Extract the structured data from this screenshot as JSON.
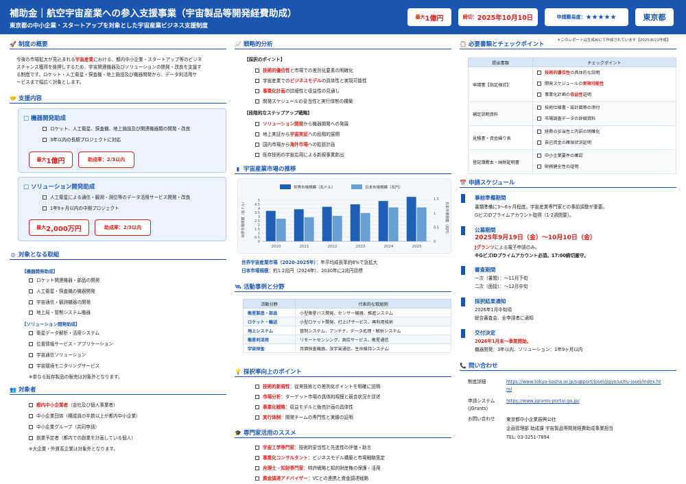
{
  "header": {
    "title": "補助金｜航空宇宙産業への参入支援事業（宇宙製品等開発経費助成）",
    "subtitle": "東京都の中小企業・スタートアップを対象とした宇宙産業ビジネス支援制度",
    "max_label": "最大",
    "max_value": "1億円",
    "deadline_label": "締切：",
    "deadline_value": "2025年10月10日",
    "difficulty_label": "申請難易度：",
    "difficulty_value": "★★★★★",
    "region": "東京都"
  },
  "note": "＊このレポートは生成AIにて作成されています【2025/8/21作成】",
  "overview": {
    "title": "制度の概要",
    "lines": [
      {
        "a": "今後の市場拡大が見込まれる",
        "h": "宇宙産業",
        "b": "における、都内中小企業・スタートアップ等のビジネ"
      },
      {
        "a": "スチャンス獲得を後押しするため、宇宙関連機器及びソリューションの開発・改良を支援す",
        "h": "",
        "b": ""
      },
      {
        "a": "る制度です。ロケット・人工衛星・探査機・地上施設及び機器開発から、データ利活用サ",
        "h": "",
        "b": ""
      },
      {
        "a": "ービスまで幅広く対象とします。",
        "h": "",
        "b": ""
      }
    ]
  },
  "support": {
    "title": "支援内容",
    "cards": [
      {
        "title": "□ 機器開発助成",
        "items": [
          "ロケット、人工衛星、探査機、地上施設及び関連機器類の開発・改良",
          "3年以内の長期プロジェクトに対応"
        ],
        "max_label": "最大",
        "max_value": "1億円",
        "rate": "助成率：2/3以内"
      },
      {
        "title": "□ ソリューション開発助成",
        "items": [
          "人工衛星による通信・観測・測位等のデータ活用サービス開発・改良",
          "1年9ヶ月以内の中期プロジェクト"
        ],
        "max_label": "最大",
        "max_value": "2,000万円",
        "rate": "助成率：2/3以内"
      }
    ]
  },
  "targets": {
    "title": "対象となる取組",
    "groups": [
      {
        "label": "【機器開発助成】",
        "items": [
          "ロケット関連機器・部品の開発",
          "人工衛星・探査機の機器開発",
          "宇宙通信・観測機器の開発",
          "地上局・管制システム機器"
        ]
      },
      {
        "label": "【ソリューション開発助成】",
        "items": [
          "衛星データ解析・活用システム",
          "位置情報サービス・アプリケーション",
          "宇宙通信ソリューション",
          "宇宙環境モニタリングサービス"
        ]
      }
    ],
    "note": "※単なる既存製品の販売は対象外となります。"
  },
  "eligible": {
    "title": "対象者",
    "items": [
      {
        "h": "都内中小企業者",
        "b": "（会社及び個人事業者）"
      },
      {
        "h": "",
        "b": "中小企業団体（構成員の半数以上が都内中小企業）"
      },
      {
        "h": "",
        "b": "中小企業グループ（共同申請）"
      },
      {
        "h": "",
        "b": "創業予定者（都内での創業を計画している個人）"
      }
    ],
    "note": "※大企業・外資系企業は対象外となります。"
  },
  "strategy": {
    "title": "戦略的分析",
    "g1": "【採択のポイント】",
    "points": [
      {
        "h": "技術的優位性",
        "b": "と市場での差別化要素の明確化"
      },
      {
        "a": "宇宙産業での",
        "h": "ビジネスモデル",
        "b": "の具体性と実現可能性"
      },
      {
        "h": "事業化計画",
        "b": "の詳細性と収益性の見通し"
      },
      {
        "a": "",
        "h": "",
        "b": "開発スケジュールの妥当性と実行体制の構築"
      }
    ],
    "g2": "【段階的なステップアップ戦略】",
    "steps": [
      {
        "h": "ソリューション開発",
        "b": "から機器開発への発展"
      },
      {
        "a": "地上実証から",
        "h": "宇宙実証",
        "b": "への段階的展開"
      },
      {
        "a": "国内市場から",
        "h": "海外市場",
        "b": "への拡張計画"
      },
      {
        "a": "",
        "h": "",
        "b": "既存技術の宇宙応用による新規事業創出"
      }
    ]
  },
  "market": {
    "title": "宇宙産業市場の推移",
    "legend_world": "世界市場規模（兆ドル）",
    "legend_japan": "日本市場規模（兆円）",
    "ylabel_left": "世界市場規模（兆ドル）",
    "ylabel_right": "日本市場規模（兆円）",
    "caption1_h": "世界宇宙産業市場（2020-2025年）",
    "caption1_b": "：年平均成長率約8%で急拡大",
    "caption2_h": "日本市場規模",
    "caption2_b": "：約1.2兆円（2024年）、2030年に2兆円目標"
  },
  "chart_data": {
    "type": "bar",
    "categories": [
      "2020",
      "2021",
      "2022",
      "2023",
      "2024",
      "2025"
    ],
    "series": [
      {
        "name": "世界市場規模（兆ドル）",
        "values": [
          3.7,
          3.9,
          4.2,
          4.5,
          4.9,
          5.4
        ]
      },
      {
        "name": "日本市場規模（兆円）",
        "values": [
          0.8,
          0.85,
          0.9,
          1.0,
          1.2,
          1.2
        ]
      }
    ],
    "y_left": {
      "ticks": [
        "0",
        "0.5",
        "1",
        "1.5",
        "2",
        "2.5",
        "3",
        "3.5",
        "4",
        "4.5",
        "5"
      ],
      "min": 0,
      "max": 5.5
    },
    "y_right": {
      "ticks": [
        "0",
        "0.5",
        "1",
        "1.5"
      ],
      "min": 0,
      "max": 1.6
    },
    "legend": "top",
    "grid": true
  },
  "activity": {
    "title": "活動事例と分野",
    "h1": "活動分野",
    "h2": "代表的な取組例",
    "rows": [
      [
        "衛星製造・部品",
        "小型衛星バス開発、センサー機器、推進システム"
      ],
      [
        "ロケット・輸送",
        "小型ロケット開発、打上げサービス、再利用技術"
      ],
      [
        "地上システム",
        "管制システム、アンテナ、データ処理・解析システム"
      ],
      [
        "衛星利活用",
        "リモートセンシング、測位サービス、衛星通信"
      ],
      [
        "宇宙探査",
        "月面探査機器、深宇宙通信、生命維持システム"
      ]
    ]
  },
  "adopt": {
    "title": "採択率向上のポイント",
    "items": [
      {
        "h": "技術的新規性",
        "b": "：従来技術との差別化ポイントを明確に説明"
      },
      {
        "h": "市場分析",
        "b": "：ターゲット市場の具体的規模と競合状況を詳述",
        "hh": "具体的規模"
      },
      {
        "h": "事業化戦略",
        "b": "：収益モデルと販売計画の具体性"
      },
      {
        "h": "実行体制",
        "b": "：開発チームの専門性と実績の証明"
      }
    ]
  },
  "expert": {
    "title": "専門家活用のススメ",
    "items": [
      {
        "h": "宇宙工学専門家",
        "b": "：技術的妥当性と先進性の評価・助言"
      },
      {
        "h": "事業化コンサルタント",
        "b": "：ビジネスモデル構築と市場戦略策定"
      },
      {
        "h": "弁理士・知財専門家",
        "b": "：特許戦略と知的財産権の保護・活用"
      },
      {
        "h": "資金調達アドバイザー",
        "b": "：VCとの連携と資金調達戦略"
      }
    ]
  },
  "docs": {
    "title": "必要書類とチェックポイント",
    "h1": "提出書類",
    "h2": "チェックポイント",
    "rows": [
      {
        "doc": "申請書【指定様式】",
        "checks": [
          {
            "h": "技術的優位性",
            "b": "の具体的な説明"
          },
          {
            "a": "開発スケジュールの",
            "h": "実現可能性",
            "b": ""
          },
          {
            "a": "事業化計画の",
            "h": "収益性",
            "b": "証明"
          }
        ]
      },
      {
        "doc": "補足説明資料",
        "checks": [
          {
            "a": "技術仕様書・設計図等の添付",
            "h": "",
            "b": ""
          },
          {
            "a": "市場調査データの詳細資料",
            "h": "",
            "b": ""
          }
        ]
      },
      {
        "doc": "見積書・資金繰り表",
        "checks": [
          {
            "a": "経費の妥当性と内訳の明確化",
            "h": "",
            "b": ""
          },
          {
            "a": "自己資金の確保状況証明",
            "h": "",
            "b": ""
          }
        ]
      },
      {
        "doc": "登記簿謄本・納税証明書",
        "checks": [
          {
            "a": "中小企業要件の確認",
            "h": "",
            "b": ""
          },
          {
            "a": "財務健全性の証明",
            "h": "",
            "b": ""
          }
        ]
      }
    ]
  },
  "schedule": {
    "title": "申請スケジュール",
    "items": [
      {
        "head": "事前準備期間",
        "lines": [
          {
            "t": "書類準備に3〜6ヶ月程度。宇宙産業専門家との事前調整が重要。"
          },
          {
            "t": "GビズIDプライムアカウント取得（1-2週間要）。"
          }
        ]
      },
      {
        "head": "公募期間",
        "lines": [
          {
            "t": "2025年9月19日（金）〜10月10日（金）",
            "cls": "red big"
          },
          {
            "t": "Jグランツ",
            "cls": "red",
            "rest": "による電子申請のみ。"
          },
          {
            "t": "※GビズIDプライムアカウント必須。17:00締切厳守。"
          }
        ]
      },
      {
        "head": "審査期間",
        "lines": [
          {
            "t": "一次（書類）：〜11月下旬"
          },
          {
            "t": "二次（面接）：〜12月中旬"
          }
        ]
      },
      {
        "head": "採択結果通知",
        "lines": [
          {
            "t": "2026年1月中旬頃"
          },
          {
            "t": "総合審査会、全申請者に通知"
          }
        ]
      },
      {
        "head": "交付決定",
        "lines": [
          {
            "t": "2026年1月末〜事業開始。",
            "cls": "red"
          },
          {
            "t": "機器開発：3年以内、ソリューション：1年9ヶ月以内"
          }
        ]
      }
    ]
  },
  "contact": {
    "title": "問い合わせ",
    "rows": [
      {
        "label": "制度詳細",
        "v1": "https://www.tokyo-kosha.or.jp/support/josei/jigyo/uchu-josei/index.ht",
        "v2": "ml",
        "link": true
      },
      {
        "label": "申請システム",
        "label2": "(jGrants)",
        "v1": "https://www.jgrants-portal.go.jp/",
        "link": true
      },
      {
        "label": "お問い合わせ",
        "v1": "東京都中小企業振興公社",
        "v2": "企画管理部 助成課 宇宙製品等開発経費助成事業担当",
        "v3": "TEL: 03-3251-7894"
      }
    ]
  }
}
